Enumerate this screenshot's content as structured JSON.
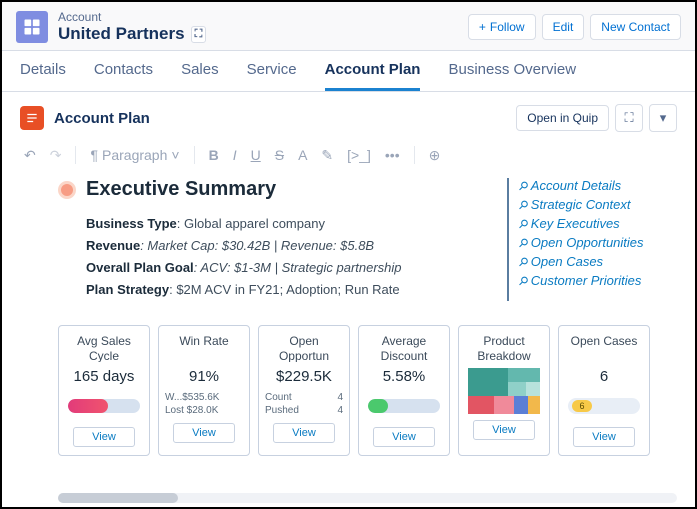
{
  "header": {
    "object_label": "Account",
    "account_name": "United Partners",
    "actions": {
      "follow": "Follow",
      "edit": "Edit",
      "new_contact": "New Contact"
    }
  },
  "tabs": [
    "Details",
    "Contacts",
    "Sales",
    "Service",
    "Account Plan",
    "Business Overview"
  ],
  "active_tab": "Account Plan",
  "subheader": {
    "title": "Account Plan",
    "open_quip": "Open in Quip"
  },
  "toolbar": {
    "style_label": "Paragraph"
  },
  "doc": {
    "exec_title": "Executive Summary",
    "lines": {
      "l1_label": "Business Type",
      "l1_val": ": Global apparel company",
      "l2_label": "Revenue",
      "l2_val": ": Market Cap: $30.42B | Revenue: $5.8B",
      "l3_label": "Overall Plan Goal",
      "l3_val": ": ACV: $1-3M | Strategic partnership",
      "l4_label": "Plan Strategy",
      "l4_val": ": $2M ACV in FY21; Adoption; Run Rate"
    }
  },
  "anchors": [
    "Account Details",
    "Strategic Context",
    "Key Executives",
    "Open Opportunities",
    "Open Cases",
    "Customer Priorities"
  ],
  "cards": [
    {
      "title": "Avg Sales Cycle",
      "value": "165 days",
      "viz": "pill-red",
      "details": []
    },
    {
      "title": "Win Rate",
      "value": "91%",
      "viz": "text",
      "details": [
        [
          "W...$535.6K",
          ""
        ],
        [
          "Lost $28.0K",
          ""
        ]
      ]
    },
    {
      "title": "Open Opportun",
      "value": "$229.5K",
      "viz": "text",
      "details": [
        [
          "Count",
          "4"
        ],
        [
          "Pushed",
          "4"
        ]
      ]
    },
    {
      "title": "Average Discount",
      "value": "5.58%",
      "viz": "pill-green",
      "details": []
    },
    {
      "title": "Product Breakdow",
      "value": "",
      "viz": "treemap",
      "details": []
    },
    {
      "title": "Open Cases",
      "value": "6",
      "viz": "pill-yellow",
      "yellow_label": "6",
      "details": []
    }
  ],
  "chart_data": [
    {
      "type": "bar",
      "title": "Avg Sales Cycle",
      "values": [
        165
      ],
      "unit": "days",
      "gauge_fill_pct": 55
    },
    {
      "type": "bar",
      "title": "Win Rate",
      "values": [
        91
      ],
      "unit": "%",
      "won_usd_k": 535.6,
      "lost_usd_k": 28.0
    },
    {
      "type": "table",
      "title": "Open Opportunities",
      "total_usd_k": 229.5,
      "rows": [
        [
          "Count",
          4
        ],
        [
          "Pushed",
          4
        ]
      ]
    },
    {
      "type": "bar",
      "title": "Average Discount",
      "values": [
        5.58
      ],
      "unit": "%",
      "gauge_fill_pct": 28
    },
    {
      "type": "heatmap",
      "title": "Product Breakdown",
      "note": "treemap proportions approximated",
      "values": [
        35,
        18,
        14,
        10,
        8,
        6,
        5,
        4
      ]
    },
    {
      "type": "bar",
      "title": "Open Cases",
      "values": [
        6
      ]
    }
  ],
  "view_label": "View"
}
